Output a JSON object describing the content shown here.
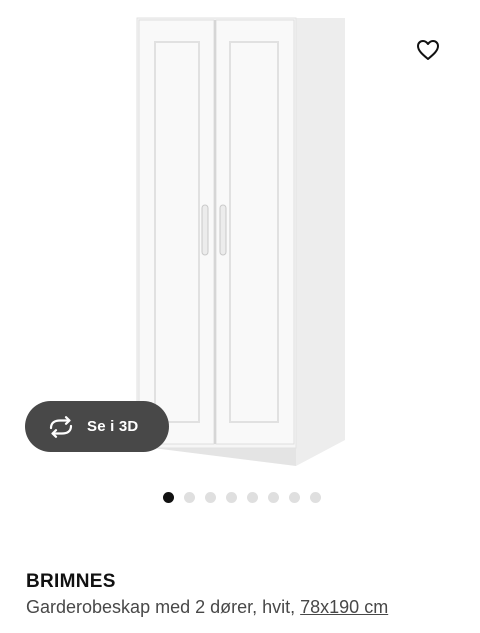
{
  "product": {
    "name": "BRIMNES",
    "description": "Garderobeskap med 2 dører, hvit, ",
    "size_link": "78x190 cm"
  },
  "gallery": {
    "view_3d_label": "Se i 3D",
    "image_count": 8,
    "active_index": 0
  },
  "icons": {
    "favorite": "heart-outline-icon",
    "view_3d": "rotate-arrows-icon"
  },
  "colors": {
    "view_3d_bg": "#484848",
    "dot_active": "#111111",
    "dot_inactive": "#dfdfdf"
  }
}
